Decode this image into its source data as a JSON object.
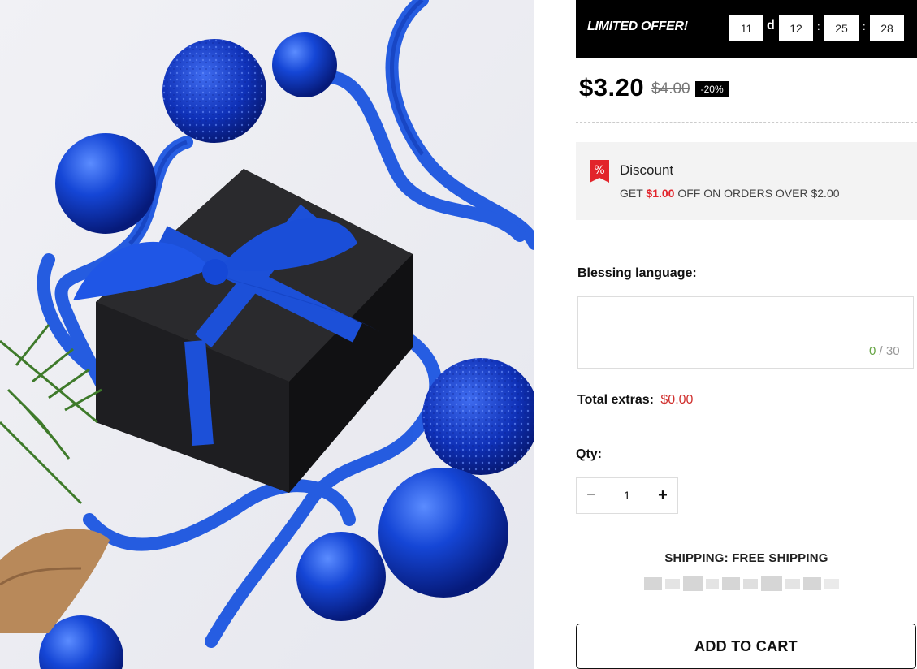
{
  "offer": {
    "label": "LIMITED OFFER!",
    "days": "11",
    "days_unit": "d",
    "hours": "12",
    "minutes": "25",
    "seconds": "28",
    "separator": ":"
  },
  "price": {
    "current": "$3.20",
    "original": "$4.00",
    "badge": "-20%"
  },
  "discount": {
    "icon": "percent-tag-icon",
    "title": "Discount",
    "prefix": "GET",
    "amount": "$1.00",
    "suffix": "OFF ON ORDERS OVER $2.00"
  },
  "blessing": {
    "label": "Blessing language:",
    "value": "",
    "count_current": "0",
    "count_separator": "/",
    "count_max": "30"
  },
  "extras": {
    "label": "Total extras:",
    "value": "$0.00"
  },
  "qty": {
    "label": "Qty:",
    "value": "1",
    "minus_icon": "minus-icon",
    "plus_icon": "plus-icon"
  },
  "shipping": {
    "text": "SHIPPING: FREE SHIPPING"
  },
  "cart": {
    "button_label": "ADD TO CART"
  },
  "colors": {
    "accent_red": "#e2242b",
    "extras_red": "#d0312f",
    "counter_green": "#67a545",
    "offer_bg": "#000000"
  }
}
